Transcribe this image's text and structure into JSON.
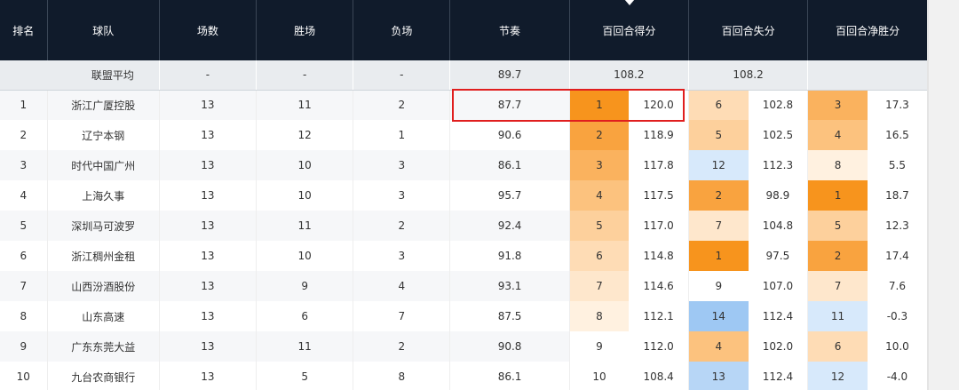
{
  "headers": {
    "rank": "排名",
    "team": "球队",
    "games": "场数",
    "wins": "胜场",
    "losses": "负场",
    "pace": "节奏",
    "off_rating": "百回合得分",
    "def_rating": "百回合失分",
    "net_rating": "百回合净胜分"
  },
  "league_avg": {
    "label": "联盟平均",
    "games": "-",
    "wins": "-",
    "losses": "-",
    "pace": "89.7",
    "off": "108.2",
    "def": "108.2",
    "net": ""
  },
  "colors": {
    "header_bg": "#101b2b",
    "highlight": "#e01e1e",
    "orange_1": "#f7941d",
    "orange_2": "#f9a33f",
    "orange_3": "#fab25e",
    "orange_4": "#fcc27e",
    "orange_5": "#fdd09c",
    "orange_6": "#fedcb5",
    "orange_7": "#fee7cc",
    "orange_8": "#fff1e0",
    "blue_1": "#d7e9fb",
    "blue_2": "#b7d6f6",
    "blue_3": "#9ec8f3"
  },
  "rows": [
    {
      "rank": "1",
      "team": "浙江广厦控股",
      "games": "13",
      "wins": "11",
      "losses": "2",
      "pace": "87.7",
      "off_rank": "1",
      "off": "120.0",
      "def_rank": "6",
      "def": "102.8",
      "net_rank": "3",
      "net": "17.3"
    },
    {
      "rank": "2",
      "team": "辽宁本钢",
      "games": "13",
      "wins": "12",
      "losses": "1",
      "pace": "90.6",
      "off_rank": "2",
      "off": "118.9",
      "def_rank": "5",
      "def": "102.5",
      "net_rank": "4",
      "net": "16.5"
    },
    {
      "rank": "3",
      "team": "时代中国广州",
      "games": "13",
      "wins": "10",
      "losses": "3",
      "pace": "86.1",
      "off_rank": "3",
      "off": "117.8",
      "def_rank": "12",
      "def": "112.3",
      "net_rank": "8",
      "net": "5.5"
    },
    {
      "rank": "4",
      "team": "上海久事",
      "games": "13",
      "wins": "10",
      "losses": "3",
      "pace": "95.7",
      "off_rank": "4",
      "off": "117.5",
      "def_rank": "2",
      "def": "98.9",
      "net_rank": "1",
      "net": "18.7"
    },
    {
      "rank": "5",
      "team": "深圳马可波罗",
      "games": "13",
      "wins": "11",
      "losses": "2",
      "pace": "92.4",
      "off_rank": "5",
      "off": "117.0",
      "def_rank": "7",
      "def": "104.8",
      "net_rank": "5",
      "net": "12.3"
    },
    {
      "rank": "6",
      "team": "浙江稠州金租",
      "games": "13",
      "wins": "10",
      "losses": "3",
      "pace": "91.8",
      "off_rank": "6",
      "off": "114.8",
      "def_rank": "1",
      "def": "97.5",
      "net_rank": "2",
      "net": "17.4"
    },
    {
      "rank": "7",
      "team": "山西汾酒股份",
      "games": "13",
      "wins": "9",
      "losses": "4",
      "pace": "93.1",
      "off_rank": "7",
      "off": "114.6",
      "def_rank": "9",
      "def": "107.0",
      "net_rank": "7",
      "net": "7.6"
    },
    {
      "rank": "8",
      "team": "山东高速",
      "games": "13",
      "wins": "6",
      "losses": "7",
      "pace": "87.5",
      "off_rank": "8",
      "off": "112.1",
      "def_rank": "14",
      "def": "112.4",
      "net_rank": "11",
      "net": "-0.3"
    },
    {
      "rank": "9",
      "team": "广东东莞大益",
      "games": "13",
      "wins": "11",
      "losses": "2",
      "pace": "90.8",
      "off_rank": "9",
      "off": "112.0",
      "def_rank": "4",
      "def": "102.0",
      "net_rank": "6",
      "net": "10.0"
    },
    {
      "rank": "10",
      "team": "九台农商银行",
      "games": "13",
      "wins": "5",
      "losses": "8",
      "pace": "86.1",
      "off_rank": "10",
      "off": "108.4",
      "def_rank": "13",
      "def": "112.4",
      "net_rank": "12",
      "net": "-4.0"
    }
  ]
}
